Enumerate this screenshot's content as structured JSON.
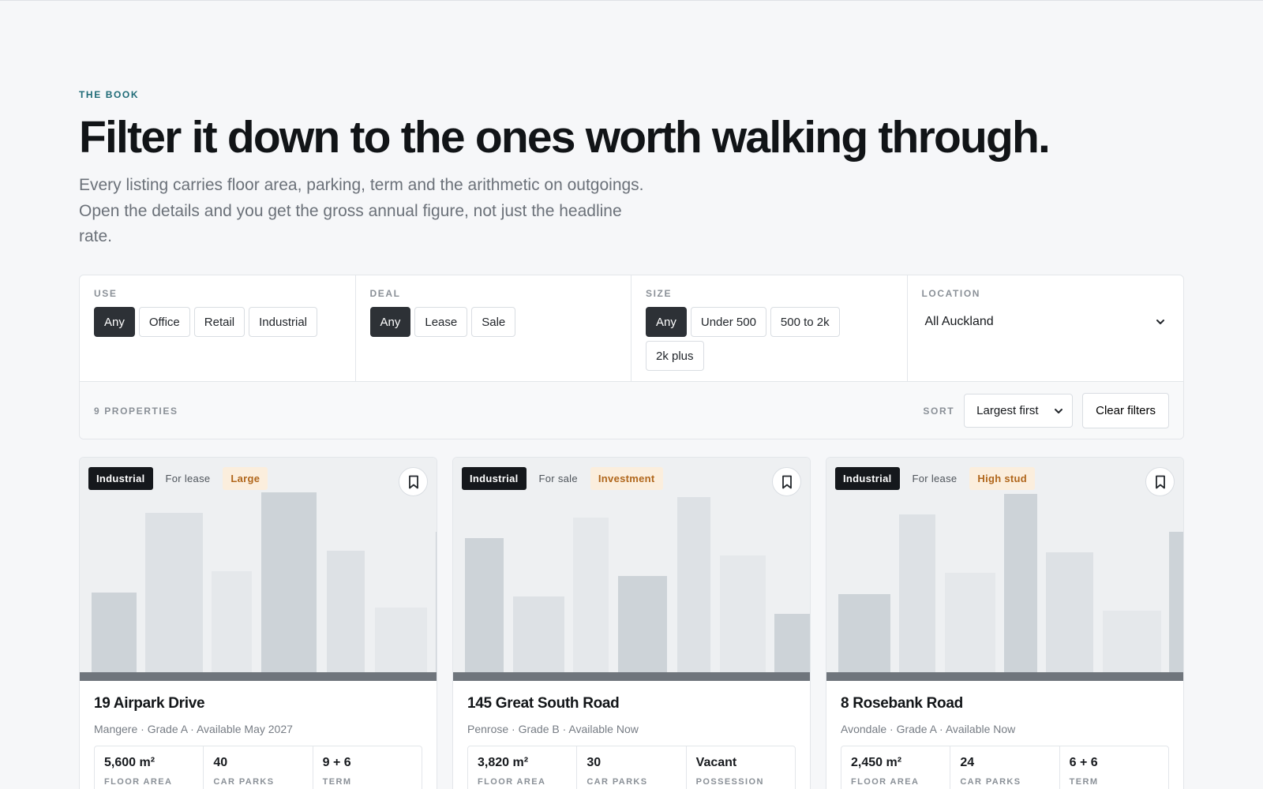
{
  "header": {
    "eyebrow": "THE BOOK",
    "headline": "Filter it down to the ones worth walking through.",
    "lede": "Every listing carries floor area, parking, term and the arithmetic on outgoings. Open the details and you get the gross annual figure, not just the headline rate."
  },
  "filters": {
    "use": {
      "label": "USE",
      "options": [
        "Any",
        "Office",
        "Retail",
        "Industrial"
      ],
      "selected": "Any"
    },
    "deal": {
      "label": "DEAL",
      "options": [
        "Any",
        "Lease",
        "Sale"
      ],
      "selected": "Any"
    },
    "size": {
      "label": "SIZE",
      "options": [
        "Any",
        "Under 500",
        "500 to 2k",
        "2k plus"
      ],
      "selected": "Any"
    },
    "location": {
      "label": "LOCATION",
      "value": "All Auckland"
    }
  },
  "results": {
    "count_label": "9 PROPERTIES",
    "sort_label": "SORT",
    "sort_value": "Largest first",
    "clear_label": "Clear filters"
  },
  "colors": {
    "accent": "#1f6b77",
    "chip_active": "#2d3136",
    "tag_accent_bg": "#fbeedd",
    "tag_accent_text": "#b0661b"
  },
  "cards": [
    {
      "tags": [
        "Industrial",
        "For lease",
        "Large"
      ],
      "address": "19 Airpark Drive",
      "meta": "Mangere · Grade A · Available May 2027",
      "stats": [
        {
          "value": "5,600 m²",
          "label": "FLOOR AREA"
        },
        {
          "value": "40",
          "label": "CAR PARKS"
        },
        {
          "value": "9 + 6",
          "label": "TERM"
        }
      ]
    },
    {
      "tags": [
        "Industrial",
        "For sale",
        "Investment"
      ],
      "address": "145 Great South Road",
      "meta": "Penrose · Grade B · Available Now",
      "stats": [
        {
          "value": "3,820 m²",
          "label": "FLOOR AREA"
        },
        {
          "value": "30",
          "label": "CAR PARKS"
        },
        {
          "value": "Vacant",
          "label": "POSSESSION"
        }
      ]
    },
    {
      "tags": [
        "Industrial",
        "For lease",
        "High stud"
      ],
      "address": "8 Rosebank Road",
      "meta": "Avondale · Grade A · Available Now",
      "stats": [
        {
          "value": "2,450 m²",
          "label": "FLOOR AREA"
        },
        {
          "value": "24",
          "label": "CAR PARKS"
        },
        {
          "value": "6 + 6",
          "label": "TERM"
        }
      ]
    }
  ]
}
